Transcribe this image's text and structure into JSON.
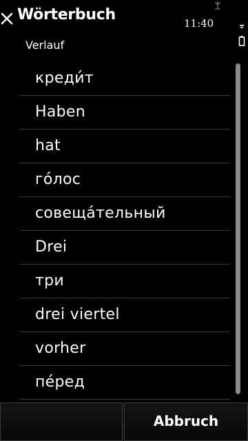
{
  "header": {
    "close_icon": "close-icon",
    "title": "Wörterbuch",
    "clock": "11:40",
    "signal_icon": "signal-antenna-icon",
    "battery_icon": "battery-icon"
  },
  "subtitle": "Verlauf",
  "history": {
    "items": [
      {
        "label": "креди́т"
      },
      {
        "label": "Haben"
      },
      {
        "label": "hat"
      },
      {
        "label": "го́лос"
      },
      {
        "label": "совеща́тельный"
      },
      {
        "label": "Drei"
      },
      {
        "label": "три"
      },
      {
        "label": "drei viertel"
      },
      {
        "label": "vorher"
      },
      {
        "label": "пе́ред"
      }
    ]
  },
  "softkeys": {
    "left_label": "",
    "right_label": "Abbruch"
  }
}
